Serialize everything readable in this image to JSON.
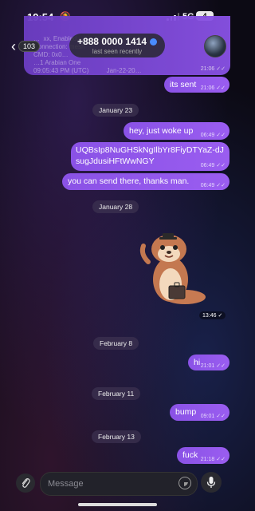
{
  "status_bar": {
    "time": "19:54",
    "network": "5G",
    "battery": "4"
  },
  "header": {
    "back_count": "103",
    "title": "+888 0000 1414",
    "subtitle": "last seen recently"
  },
  "top_message": {
    "faint_text": "…  xx, Enabled\nConnection: mesh\nCMD: 0x0…\n…1 Arabian One\n09:05:43 PM (UTC)          Jan-22-20…",
    "time": "21:06"
  },
  "messages": [
    {
      "id": "its-sent",
      "text": "its sent",
      "time": "21:06"
    },
    {
      "id": "just-woke-up",
      "text": "hey, just woke up",
      "time": "06:49"
    },
    {
      "id": "address",
      "text": "UQBsIp8NuGHSkNgIlbYr8FiyDTYaZ-dJsugJdusiHFtWwNGY",
      "time": "06:49"
    },
    {
      "id": "send-there",
      "text": "you can send there, thanks man.",
      "time": "06:49"
    },
    {
      "id": "hi",
      "text": "hi",
      "time": "21:01"
    },
    {
      "id": "bump",
      "text": "bump",
      "time": "09:01"
    },
    {
      "id": "fuck",
      "text": "fuck",
      "time": "21:18"
    }
  ],
  "dates": {
    "jan23": "January 23",
    "jan28": "January 28",
    "feb8": "February 8",
    "feb11": "February 11",
    "feb13": "February 13"
  },
  "sticker": {
    "time": "13:46"
  },
  "input": {
    "placeholder": "Message"
  },
  "colors": {
    "outgoing_bubble": "#9a5df0",
    "background": "#0c0a14",
    "accent": "#4a8cff"
  }
}
